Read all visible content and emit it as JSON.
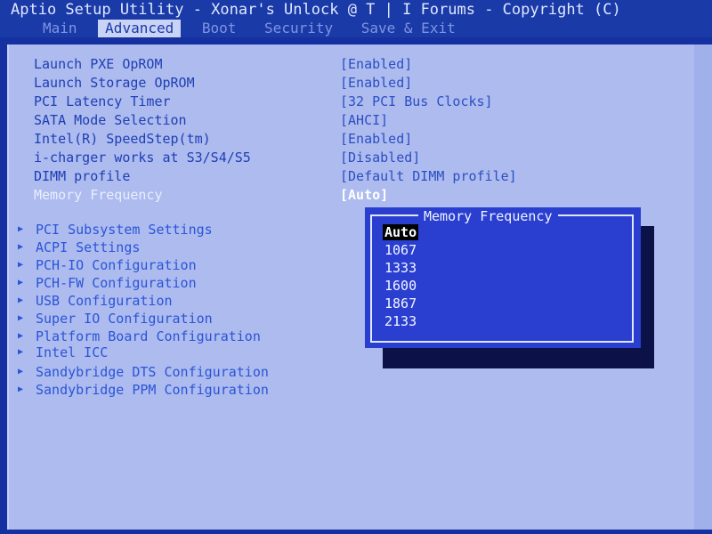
{
  "title": "Aptio Setup Utility - Xonar's Unlock @ T | I Forums - Copyright (C)",
  "tabs": [
    {
      "label": "Main",
      "active": false
    },
    {
      "label": "Advanced",
      "active": true
    },
    {
      "label": "Boot",
      "active": false
    },
    {
      "label": "Security",
      "active": false
    },
    {
      "label": "Save & Exit",
      "active": false
    }
  ],
  "settings": [
    {
      "label": "Launch PXE OpROM",
      "value": "[Enabled]"
    },
    {
      "label": "Launch Storage OpROM",
      "value": "[Enabled]"
    },
    {
      "label": "PCI Latency Timer",
      "value": "[32 PCI Bus Clocks]"
    },
    {
      "label": "SATA Mode Selection",
      "value": "[AHCI]"
    },
    {
      "label": "Intel(R) SpeedStep(tm)",
      "value": "[Enabled]"
    },
    {
      "label": "i-charger works at S3/S4/S5",
      "value": "[Disabled]"
    },
    {
      "label": "DIMM profile",
      "value": "[Default DIMM profile]"
    },
    {
      "label": "Memory Frequency",
      "value": "[Auto]"
    }
  ],
  "submenus": [
    "PCI Subsystem Settings",
    "ACPI Settings",
    "PCH-IO Configuration",
    "PCH-FW Configuration",
    "USB Configuration",
    "Super IO Configuration",
    "Platform Board Configuration",
    "Intel ICC",
    "Sandybridge DTS Configuration",
    "Sandybridge PPM Configuration"
  ],
  "popup": {
    "title": "Memory Frequency",
    "options": [
      "Auto",
      "1067",
      "1333",
      "1600",
      "1867",
      "2133"
    ],
    "selected": "Auto"
  },
  "colors": {
    "background": "#1530a0",
    "panel": "#aebbee",
    "popup": "#2a3fd0",
    "label": "#1d3fb5"
  },
  "icons": {
    "submenu_marker": "triangle-right-icon"
  }
}
